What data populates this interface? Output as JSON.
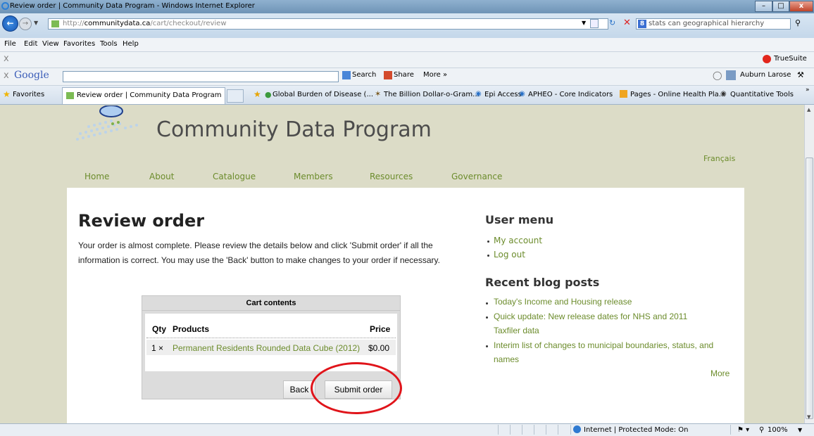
{
  "window": {
    "title": "Review order | Community Data Program - Windows Internet Explorer",
    "address": "http://communitydata.ca/cart/checkout/review",
    "address_domain": "communitydata.ca",
    "address_path": "/cart/checkout/review",
    "search_text": "stats can geographical hierarchy"
  },
  "menu": [
    "File",
    "Edit",
    "View",
    "Favorites",
    "Tools",
    "Help"
  ],
  "toolbar": {
    "x_label": "x",
    "truesuite": "TrueSuite",
    "google_logo": "Google",
    "search_btn": "Search",
    "share_btn": "Share",
    "more_btn": "More »",
    "user": "Auburn Larose"
  },
  "favorites": {
    "label": "Favorites",
    "tab": "Review order | Community Data Program",
    "links": [
      "Global Burden of Disease (...",
      "The Billion Dollar-o-Gram...",
      "Epi Access",
      "APHEO - Core Indicators",
      "Pages - Online Health Pla...",
      "Quantitative Tools"
    ]
  },
  "site": {
    "title": "Community Data Program",
    "lang_link": "Français",
    "nav": [
      "Home",
      "About",
      "Catalogue",
      "Members",
      "Resources",
      "Governance"
    ]
  },
  "main": {
    "heading": "Review order",
    "intro": "Your order is almost complete. Please review the details below and click 'Submit order' if all the information is correct. You may use the 'Back' button to make changes to your order if necessary.",
    "cart": {
      "header": "Cart contents",
      "col_qty": "Qty",
      "col_products": "Products",
      "col_price": "Price",
      "item_qty": "1 ×",
      "item_name": "Permanent Residents Rounded Data Cube (2012)",
      "item_price": "$0.00",
      "back_label": "Back",
      "submit_label": "Submit order"
    }
  },
  "sidebar": {
    "user_menu_title": "User menu",
    "user_links": [
      "My account",
      "Log out"
    ],
    "blog_title": "Recent blog posts",
    "posts": [
      "Today's Income and Housing release",
      "Quick update: New release dates for NHS and 2011",
      "Taxfiler data",
      "Interim list of changes to municipal boundaries, status, and",
      "names"
    ],
    "more": "More"
  },
  "status": {
    "zone": "Internet | Protected Mode: On",
    "zoom": "100%"
  },
  "colors": {
    "link": "#6c8c2c",
    "page_bg": "#dcdcc7",
    "highlight_circle": "#e0141a"
  }
}
